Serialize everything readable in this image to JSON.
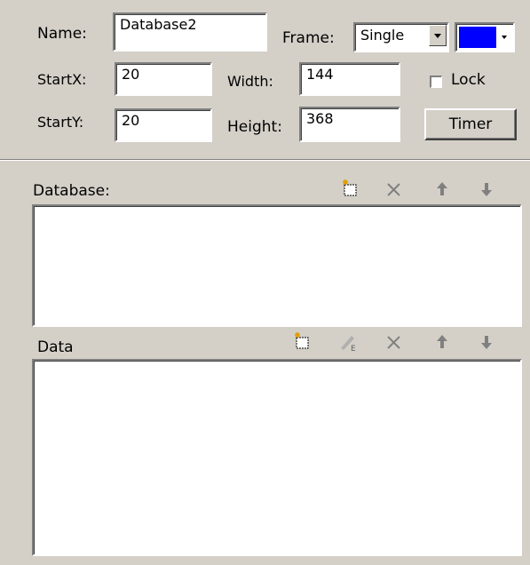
{
  "props": {
    "name_label": "Name:",
    "name_value": "Database2",
    "frame_label": "Frame:",
    "frame_value": "Single",
    "color_value": "#0000ff",
    "startx_label": "StartX:",
    "startx_value": "20",
    "width_label": "Width:",
    "width_value": "144",
    "lock_label": "Lock",
    "lock_checked": false,
    "starty_label": "StartY:",
    "starty_value": "20",
    "height_label": "Height:",
    "height_value": "368",
    "timer_label": "Timer"
  },
  "database_section": {
    "label": "Database:",
    "icons": [
      "new-icon",
      "delete-icon",
      "move-up-icon",
      "move-down-icon"
    ]
  },
  "data_section": {
    "label": "Data",
    "icons": [
      "new-icon",
      "edit-icon",
      "delete-icon",
      "move-up-icon",
      "move-down-icon"
    ]
  }
}
